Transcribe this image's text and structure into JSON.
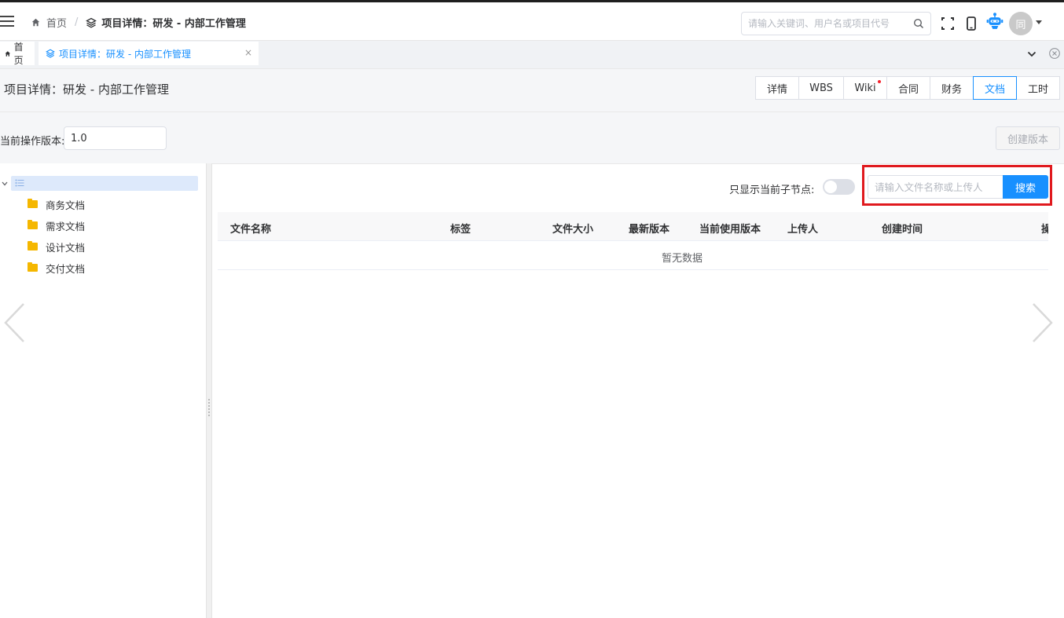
{
  "header": {
    "breadcrumb": {
      "home": "首页",
      "separator": "/",
      "current": "项目详情：研发 - 内部工作管理"
    },
    "search": {
      "placeholder": "请输入关键词、用户名或项目代号"
    },
    "avatar_text": "同",
    "icons": [
      "menu-icon",
      "home-icon",
      "layers-icon",
      "search-icon",
      "fullscreen-icon",
      "mobile-icon",
      "robot-icon"
    ]
  },
  "tagbar": {
    "home_tag": "首页",
    "active_tag": "项目详情：研发 - 内部工作管理",
    "close_glyph": "×"
  },
  "page": {
    "title": "项目详情：研发 - 内部工作管理",
    "tabs": [
      {
        "label": "详情"
      },
      {
        "label": "WBS"
      },
      {
        "label": "Wiki"
      },
      {
        "label": "合同"
      },
      {
        "label": "财务"
      },
      {
        "label": "文档"
      },
      {
        "label": "工时"
      }
    ],
    "active_tab": "文档",
    "version_label": "当前操作版本:",
    "version_value": "1.0",
    "create_version_button": "创建版本"
  },
  "tree": {
    "items": [
      {
        "label": "商务文档"
      },
      {
        "label": "需求文档"
      },
      {
        "label": "设计文档"
      },
      {
        "label": "交付文档"
      }
    ]
  },
  "files": {
    "only_current_label": "只显示当前子节点:",
    "search_placeholder": "请输入文件名称或上传人",
    "search_button": "搜索",
    "columns": [
      "文件名称",
      "标签",
      "文件大小",
      "最新版本",
      "当前使用版本",
      "上传人",
      "创建时间",
      "操作"
    ],
    "empty_text": "暂无数据"
  },
  "colors": {
    "primary": "#1890ff",
    "highlight": "#e0191e",
    "folder": "#f5b700",
    "notification_dot": "#f5222d"
  }
}
